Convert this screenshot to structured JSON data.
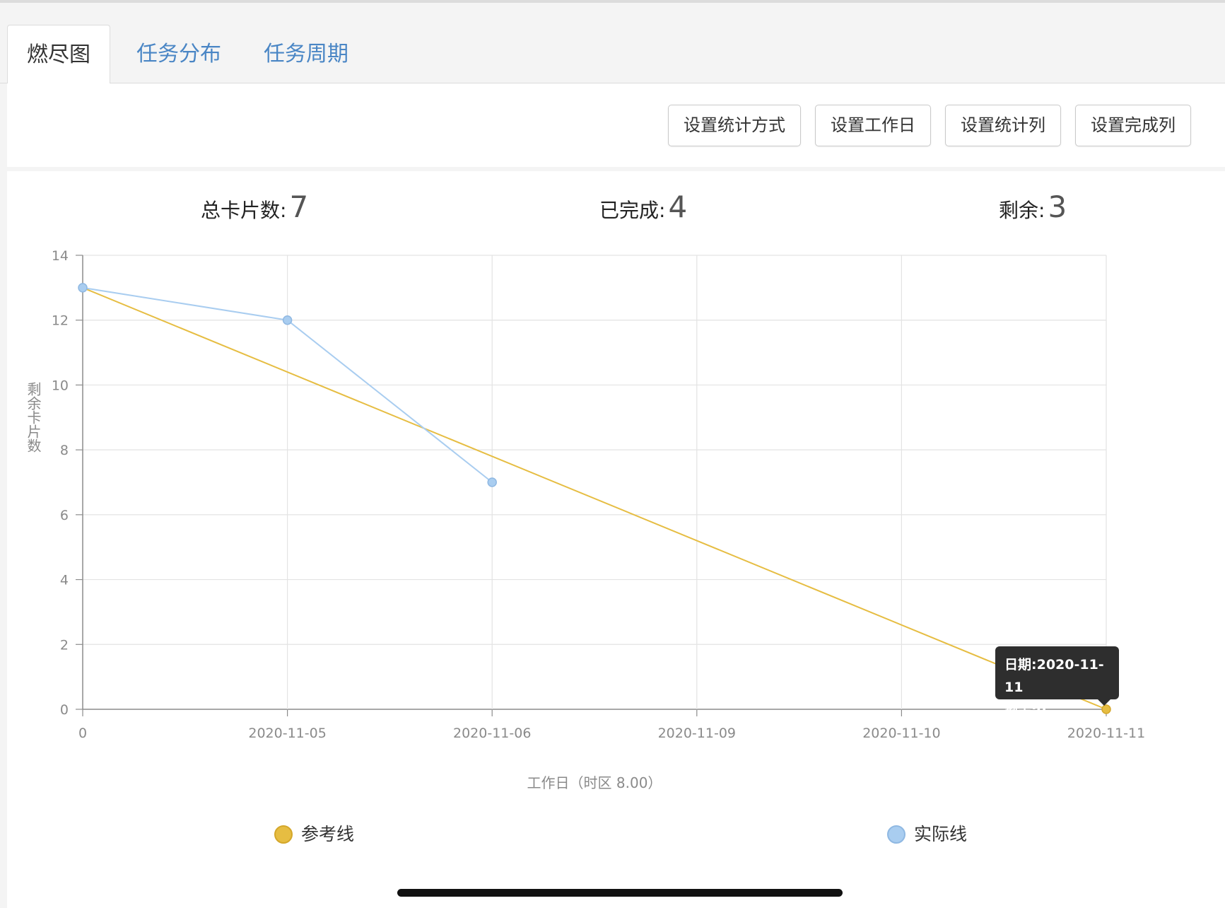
{
  "tabs": [
    {
      "label": "燃尽图",
      "active": true
    },
    {
      "label": "任务分布",
      "active": false
    },
    {
      "label": "任务周期",
      "active": false
    }
  ],
  "toolbar": {
    "buttons": [
      "设置统计方式",
      "设置工作日",
      "设置统计列",
      "设置完成列"
    ]
  },
  "stats": {
    "total_label": "总卡片数:",
    "total_value": "7",
    "done_label": "已完成:",
    "done_value": "4",
    "remaining_label": "剩余:",
    "remaining_value": "3"
  },
  "chart_data": {
    "type": "line",
    "categories": [
      "0",
      "2020-11-05",
      "2020-11-06",
      "2020-11-09",
      "2020-11-10",
      "2020-11-11"
    ],
    "xlabel": "工作日（时区 8.00）",
    "ylabel": "剩余卡片数",
    "ylim": [
      0,
      14
    ],
    "yticks": [
      0,
      2,
      4,
      6,
      8,
      10,
      12,
      14
    ],
    "grid": true,
    "legend_position": "bottom",
    "series": [
      {
        "name": "参考线",
        "color": "#e6bd42",
        "values": [
          13,
          null,
          null,
          null,
          null,
          0
        ]
      },
      {
        "name": "实际线",
        "color": "#a9cdf0",
        "values": [
          13,
          12,
          7,
          null,
          null,
          null
        ]
      }
    ],
    "tooltip": {
      "line1": "日期:2020-11-11",
      "line2": "剩余:0"
    }
  },
  "colors": {
    "tab_link": "#4a86c5",
    "reference": "#e6bd42",
    "actual": "#a9cdf0"
  }
}
